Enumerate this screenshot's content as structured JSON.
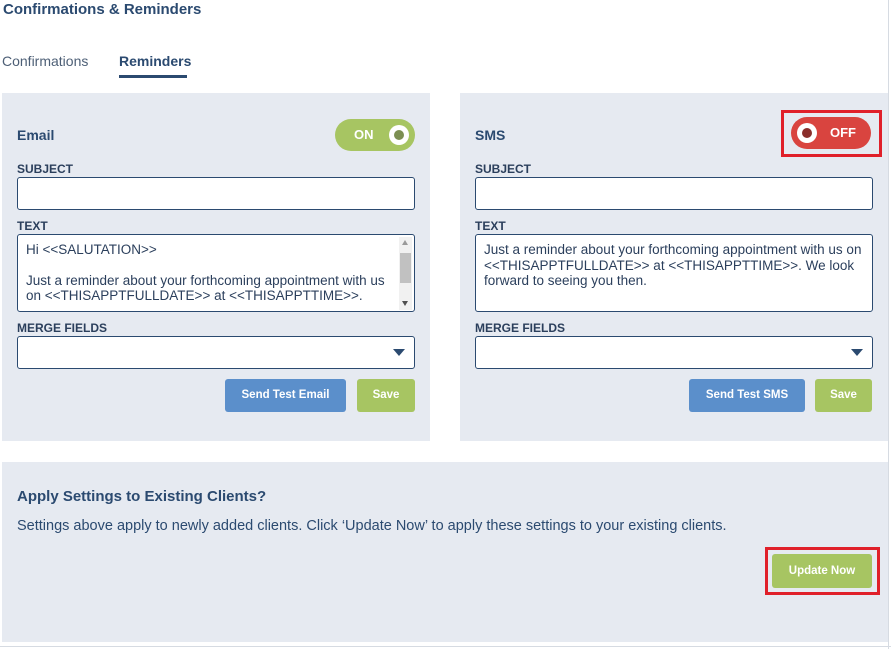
{
  "page": {
    "title": "Confirmations & Reminders"
  },
  "tabs": [
    {
      "label": "Confirmations",
      "active": false
    },
    {
      "label": "Reminders",
      "active": true
    }
  ],
  "email": {
    "heading": "Email",
    "toggle": {
      "label": "ON",
      "state": "on",
      "color": "#a7c562"
    },
    "subject_label": "SUBJECT",
    "subject_value": "",
    "text_label": "TEXT",
    "text_lines": [
      "Hi <<SALUTATION>>",
      "Just a reminder about your forthcoming appointment with us on <<THISAPPTFULLDATE>> at <<THISAPPTTIME>>."
    ],
    "merge_label": "MERGE FIELDS",
    "merge_value": "",
    "send_test_label": "Send Test Email",
    "save_label": "Save"
  },
  "sms": {
    "heading": "SMS",
    "toggle": {
      "label": "OFF",
      "state": "off",
      "color": "#d9443f"
    },
    "subject_label": "SUBJECT",
    "subject_value": "",
    "text_label": "TEXT",
    "text": "Just a reminder about your forthcoming appointment with us on <<THISAPPTFULLDATE>> at <<THISAPPTTIME>>. We look forward to seeing you then.",
    "merge_label": "MERGE FIELDS",
    "merge_value": "",
    "send_test_label": "Send Test SMS",
    "save_label": "Save"
  },
  "apply": {
    "title": "Apply Settings to Existing Clients?",
    "description": "Settings above apply to newly added clients. Click ‘Update Now’ to apply these settings to your existing clients.",
    "update_label": "Update Now"
  },
  "colors": {
    "primary": "#2b4a70",
    "button_blue": "#5b8fcb",
    "button_green": "#a7c562",
    "toggle_off": "#d9443f",
    "highlight": "#e0202a",
    "panel_bg": "#e6eaf1"
  },
  "icons": {
    "dropdown": "chevron-down-icon",
    "toggle_knob": "toggle-knob-icon"
  }
}
